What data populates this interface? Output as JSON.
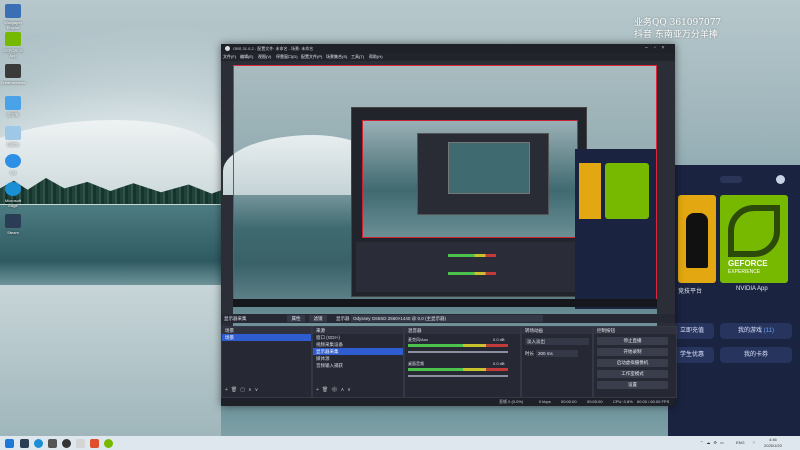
{
  "watermark": {
    "line1": "业务QQ 361097077",
    "line2": "抖音 东南亚万分羊捧"
  },
  "desktop_icons": [
    {
      "label": "Wallpaper Engine",
      "color": "#3b6fb5"
    },
    {
      "label": "GEFORCE App",
      "color": "#76b900"
    },
    {
      "label": "Dreamweaver",
      "color": "#3a3a3a"
    },
    {
      "label": "此电脑",
      "color": "#4aa3e8"
    },
    {
      "label": "回收站",
      "color": "#9fc7e6"
    },
    {
      "label": "QQ",
      "color": "#2e8fe6"
    },
    {
      "label": "Microsoft Edge",
      "color": "#1a8fd6"
    },
    {
      "label": "Steam",
      "color": "#2b3c55"
    }
  ],
  "obs": {
    "title": "OBS 31.0.2 - 配置文件: 未命名 - 场景: 未命名",
    "menu": [
      "文件(F)",
      "编辑(E)",
      "视图(V)",
      "停靠窗口(D)",
      "配置文件(P)",
      "场景集合(S)",
      "工具(T)",
      "帮助(H)"
    ],
    "source_bar": {
      "source_name": "显示器采集",
      "properties": "属性",
      "filters": "滤镜",
      "display_label": "显示器",
      "display_value": "Odyssey G65SD 2560×1440 @ 0,0 (主显示器)"
    },
    "scenes": {
      "title": "场景",
      "items": [
        "场景"
      ]
    },
    "sources": {
      "title": "来源",
      "items": [
        "窗口 (GDI+)",
        "视频采集设备",
        "显示器采集",
        "媒体源",
        "音频输入捕获"
      ]
    },
    "mixer": {
      "title": "混音器",
      "ch1": "麦克风/Aux",
      "ch1_db": "0.0 dB",
      "ch2": "桌面音频",
      "ch2_db": "0.0 dB"
    },
    "transitions": {
      "title": "转场动画",
      "type": "淡入淡出",
      "duration_label": "时长",
      "duration_value": "300 ms"
    },
    "controls": {
      "title": "控制按钮",
      "buttons": [
        "停止直播",
        "开始录制",
        "启动虚拟摄像机",
        "工作室模式",
        "设置"
      ]
    },
    "status": {
      "frames": "丢帧 0 (0.0%)",
      "bitrate": "0 kbps",
      "stream_time": "00:00:00",
      "rec_time": "00:00:00",
      "cpu": "CPU: 0.8%",
      "fps": "60.00 / 60.00 FPS"
    }
  },
  "nvidia": {
    "card1_label": "竞技平台",
    "card2_title": "GEFORCE",
    "card2_sub": "EXPERIENCE",
    "card2_label": "NVIDIA App",
    "btn_recharge": "立即充值",
    "btn_games": "我的游戏",
    "games_count": "(11)",
    "btn_student": "学生优惠",
    "btn_card": "我的卡券"
  },
  "taskbar": {
    "lang": "ENG",
    "time": "4:46",
    "date": "2025/1/20"
  },
  "colors": {
    "obs_bg": "#2b2d37",
    "selection": "#2f5dd0",
    "nv_green": "#76b900",
    "red_border": "#e0263a"
  }
}
